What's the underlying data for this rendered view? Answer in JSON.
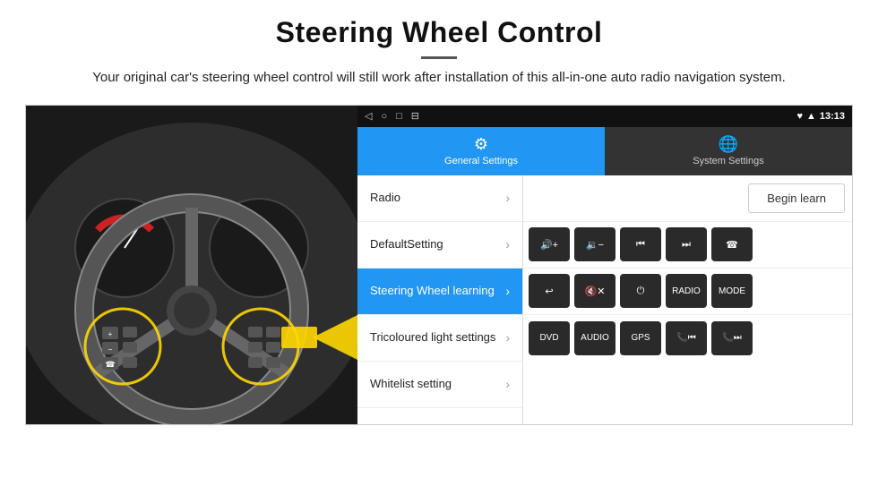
{
  "header": {
    "title": "Steering Wheel Control",
    "subtitle": "Your original car's steering wheel control will still work after installation of this all-in-one auto radio navigation system."
  },
  "status_bar": {
    "nav_icons": [
      "◁",
      "○",
      "□",
      "⊟"
    ],
    "right_icons": "♥ ▲",
    "time": "13:13"
  },
  "tabs": [
    {
      "id": "general",
      "label": "General Settings",
      "active": true
    },
    {
      "id": "system",
      "label": "System Settings",
      "active": false
    }
  ],
  "menu_items": [
    {
      "id": "radio",
      "label": "Radio",
      "active": false
    },
    {
      "id": "default",
      "label": "DefaultSetting",
      "active": false
    },
    {
      "id": "steering",
      "label": "Steering Wheel learning",
      "active": true
    },
    {
      "id": "tricoloured",
      "label": "Tricoloured light settings",
      "active": false
    },
    {
      "id": "whitelist",
      "label": "Whitelist setting",
      "active": false
    }
  ],
  "controls": {
    "begin_learn": "Begin learn",
    "row1": [
      {
        "id": "vol-up",
        "symbol": "◀+",
        "label": "Vol Up"
      },
      {
        "id": "vol-down",
        "symbol": "◀−",
        "label": "Vol Down"
      },
      {
        "id": "prev",
        "symbol": "⏮",
        "label": "Previous"
      },
      {
        "id": "next",
        "symbol": "⏭",
        "label": "Next"
      },
      {
        "id": "phone",
        "symbol": "☎",
        "label": "Phone"
      }
    ],
    "row2": [
      {
        "id": "hang-up",
        "symbol": "↩",
        "label": "Hang Up"
      },
      {
        "id": "mute",
        "symbol": "◀✕",
        "label": "Mute"
      },
      {
        "id": "power",
        "symbol": "⏻",
        "label": "Power"
      },
      {
        "id": "radio-btn",
        "symbol": "RADIO",
        "label": "Radio"
      },
      {
        "id": "mode",
        "symbol": "MODE",
        "label": "Mode"
      }
    ],
    "row3": [
      {
        "id": "dvd",
        "symbol": "DVD",
        "label": "DVD"
      },
      {
        "id": "audio",
        "symbol": "AUDIO",
        "label": "Audio"
      },
      {
        "id": "gps",
        "symbol": "GPS",
        "label": "GPS"
      },
      {
        "id": "tel-prev",
        "symbol": "📞⏮",
        "label": "Tel Prev"
      },
      {
        "id": "tel-next",
        "symbol": "📞⏭",
        "label": "Tel Next"
      }
    ],
    "whitelist_icon": "☰"
  }
}
